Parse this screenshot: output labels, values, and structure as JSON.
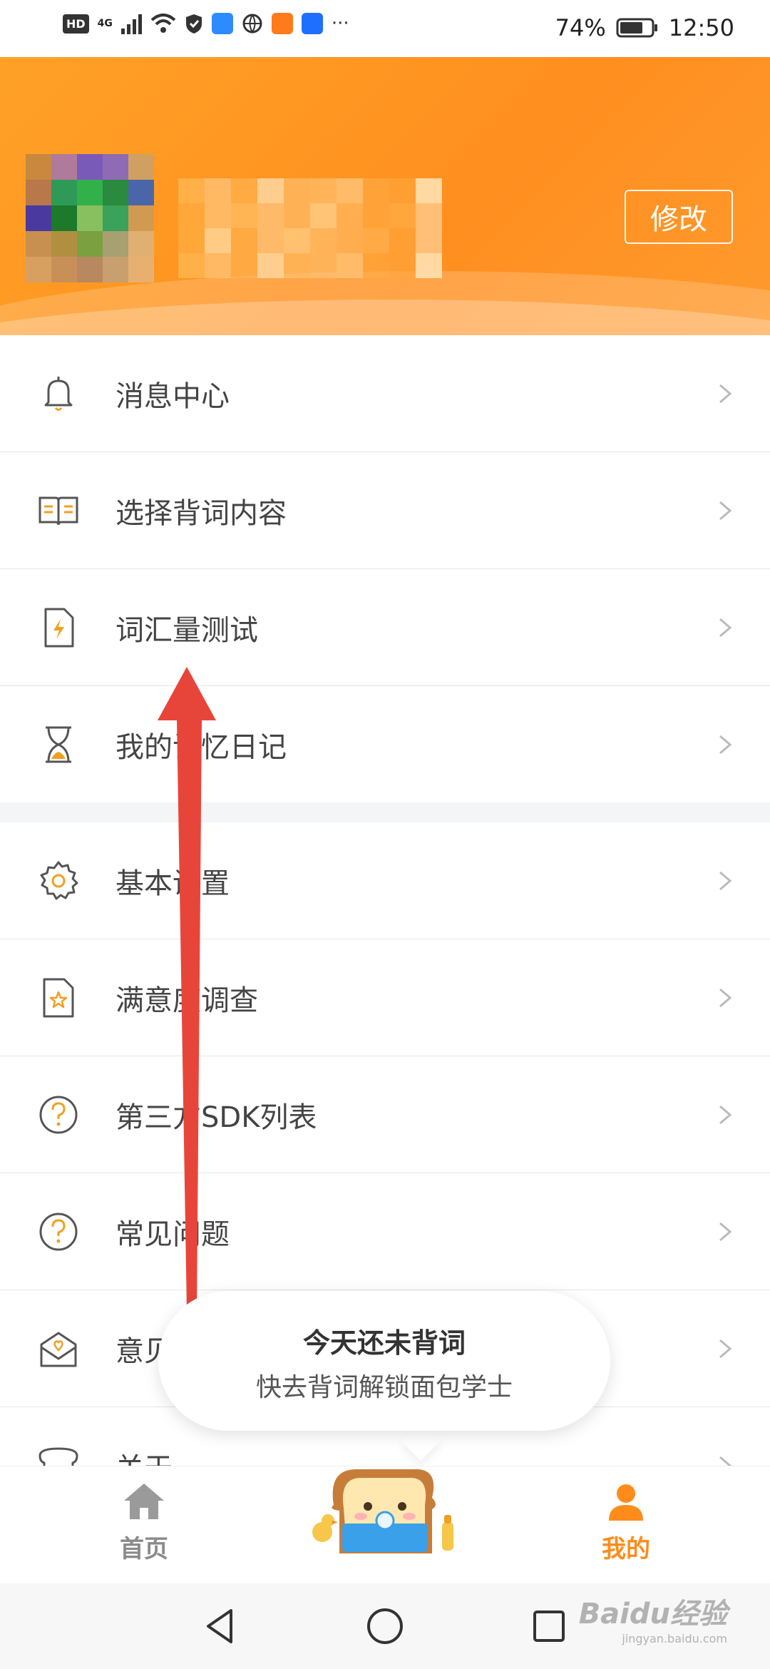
{
  "status_bar": {
    "hd_badge": "HD",
    "network_type": "4G",
    "battery_percent": "74%",
    "battery_level": 0.74,
    "time": "12:50",
    "more": "···"
  },
  "header": {
    "edit_button": "修改",
    "accent_color": "#ff9a22"
  },
  "menu_group_1": [
    {
      "label": "消息中心",
      "icon": "bell-icon"
    },
    {
      "label": "选择背词内容",
      "icon": "book-icon"
    },
    {
      "label": "词汇量测试",
      "icon": "flash-doc-icon"
    },
    {
      "label": "我的记忆日记",
      "icon": "hourglass-icon"
    }
  ],
  "menu_group_2": [
    {
      "label": "基本设置",
      "icon": "gear-icon"
    },
    {
      "label": "满意度调查",
      "icon": "star-doc-icon"
    },
    {
      "label": "第三方SDK列表",
      "icon": "question-icon"
    },
    {
      "label": "常见问题",
      "icon": "question-icon"
    },
    {
      "label": "意见反馈",
      "icon": "heart-mail-icon"
    },
    {
      "label": "关于",
      "icon": "bread-icon"
    }
  ],
  "bubble": {
    "title": "今天还未背词",
    "subtitle": "快去背词解锁面包学士"
  },
  "tabbar": {
    "home_label": "首页",
    "me_label": "我的",
    "active_color": "#ff8c1a"
  },
  "watermark": {
    "text": "Baidu经验",
    "sub": "jingyan.baidu.com"
  }
}
